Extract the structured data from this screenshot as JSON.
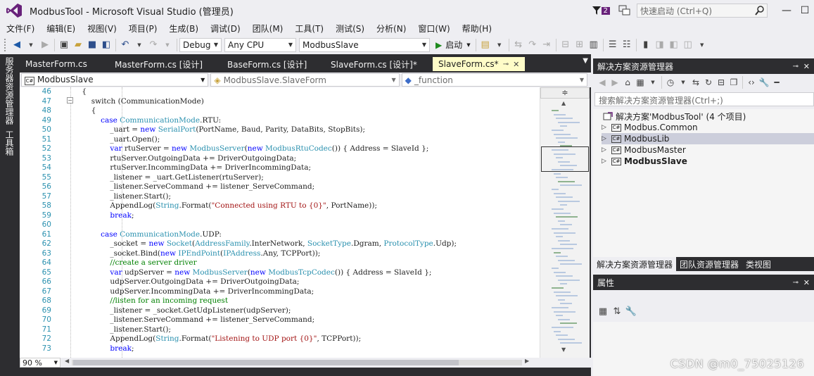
{
  "window": {
    "title": "ModbusTool - Microsoft Visual Studio (管理员)",
    "notification_count": "2",
    "quick_launch_placeholder": "快速启动 (Ctrl+Q)"
  },
  "menu": [
    "文件(F)",
    "编辑(E)",
    "视图(V)",
    "项目(P)",
    "生成(B)",
    "调试(D)",
    "团队(M)",
    "工具(T)",
    "测试(S)",
    "分析(N)",
    "窗口(W)",
    "帮助(H)"
  ],
  "toolbar": {
    "config": "Debug",
    "platform": "Any CPU",
    "startup_project": "ModbusSlave",
    "start_label": "启动"
  },
  "left_strip": {
    "server_explorer": "服务器资源管理器",
    "toolbox": "工具箱"
  },
  "editor": {
    "tabs": [
      {
        "label": "MasterForm.cs"
      },
      {
        "label": "MasterForm.cs [设计]"
      },
      {
        "label": "BaseForm.cs [设计]"
      },
      {
        "label": "SlaveForm.cs [设计]*"
      },
      {
        "label": "SlaveForm.cs*",
        "active": true
      }
    ],
    "nav": {
      "project": "ModbusSlave",
      "type": "ModbusSlave.SlaveForm",
      "member": "_function"
    },
    "zoom": "90 %",
    "lines": [
      {
        "n": "46",
        "html": "    {"
      },
      {
        "n": "47",
        "html": "        switch (CommunicationMode)"
      },
      {
        "n": "48",
        "html": "        {"
      },
      {
        "n": "49",
        "html": "            <span class=\"kw\">case</span> <span class=\"ty\">CommunicationMode</span>.RTU:"
      },
      {
        "n": "50",
        "html": "                _uart = <span class=\"kw\">new</span> <span class=\"ty\">SerialPort</span>(PortName, Baud, Parity, DataBits, StopBits);"
      },
      {
        "n": "51",
        "html": "                _uart.Open();"
      },
      {
        "n": "52",
        "html": "                <span class=\"kw\">var</span> rtuServer = <span class=\"kw\">new</span> <span class=\"ty\">ModbusServer</span>(<span class=\"kw\">new</span> <span class=\"ty\">ModbusRtuCodec</span>()) { Address = SlaveId };"
      },
      {
        "n": "53",
        "html": "                rtuServer.OutgoingData += DriverOutgoingData;"
      },
      {
        "n": "54",
        "html": "                rtuServer.IncommingData += DriverIncommingData;"
      },
      {
        "n": "55",
        "html": "                _listener = _uart.GetListener(rtuServer);"
      },
      {
        "n": "56",
        "html": "                _listener.ServeCommand += listener_ServeCommand;"
      },
      {
        "n": "57",
        "html": "                _listener.Start();"
      },
      {
        "n": "58",
        "html": "                AppendLog(<span class=\"ty\">String</span>.Format(<span class=\"st\">\"Connected using RTU to {0}\"</span>, PortName));"
      },
      {
        "n": "59",
        "html": "                <span class=\"kw\">break</span>;"
      },
      {
        "n": "60",
        "html": ""
      },
      {
        "n": "61",
        "html": "            <span class=\"kw\">case</span> <span class=\"ty\">CommunicationMode</span>.UDP:"
      },
      {
        "n": "62",
        "html": "                _socket = <span class=\"kw\">new</span> <span class=\"ty\">Socket</span>(<span class=\"ty\">AddressFamily</span>.InterNetwork, <span class=\"ty\">SocketType</span>.Dgram, <span class=\"ty\">ProtocolType</span>.Udp);"
      },
      {
        "n": "63",
        "html": "                _socket.Bind(<span class=\"kw\">new</span> <span class=\"ty\">IPEndPoint</span>(<span class=\"ty\">IPAddress</span>.Any, TCPPort));"
      },
      {
        "n": "64",
        "html": "                <span class=\"cm\">//create a server driver</span>"
      },
      {
        "n": "65",
        "html": "                <span class=\"kw\">var</span> udpServer = <span class=\"kw\">new</span> <span class=\"ty\">ModbusServer</span>(<span class=\"kw\">new</span> <span class=\"ty\">ModbusTcpCodec</span>()) { Address = SlaveId };"
      },
      {
        "n": "66",
        "html": "                udpServer.OutgoingData += DriverOutgoingData;"
      },
      {
        "n": "67",
        "html": "                udpServer.IncommingData += DriverIncommingData;"
      },
      {
        "n": "68",
        "html": "                <span class=\"cm\">//listen for an incoming request</span>"
      },
      {
        "n": "69",
        "html": "                _listener = _socket.GetUdpListener(udpServer);"
      },
      {
        "n": "70",
        "html": "                _listener.ServeCommand += listener_ServeCommand;"
      },
      {
        "n": "71",
        "html": "                _listener.Start();"
      },
      {
        "n": "72",
        "html": "                AppendLog(<span class=\"ty\">String</span>.Format(<span class=\"st\">\"Listening to UDP port {0}\"</span>, TCPPort));"
      },
      {
        "n": "73",
        "html": "                <span class=\"kw\">break</span>;"
      }
    ]
  },
  "solution_explorer": {
    "title": "解决方案资源管理器",
    "search_placeholder": "搜索解决方案资源管理器(Ctrl+;)",
    "solution_label": "解决方案'ModbusTool' (4 个项目)",
    "projects": [
      {
        "name": "Modbus.Common",
        "selected": false,
        "bold": false
      },
      {
        "name": "ModbusLib",
        "selected": true,
        "bold": false
      },
      {
        "name": "ModbusMaster",
        "selected": false,
        "bold": false
      },
      {
        "name": "ModbusSlave",
        "selected": false,
        "bold": true
      }
    ],
    "bottom_tabs": [
      "解决方案资源管理器",
      "团队资源管理器",
      "类视图"
    ]
  },
  "properties": {
    "title": "属性"
  },
  "watermark": "CSDN @m0_75025126"
}
